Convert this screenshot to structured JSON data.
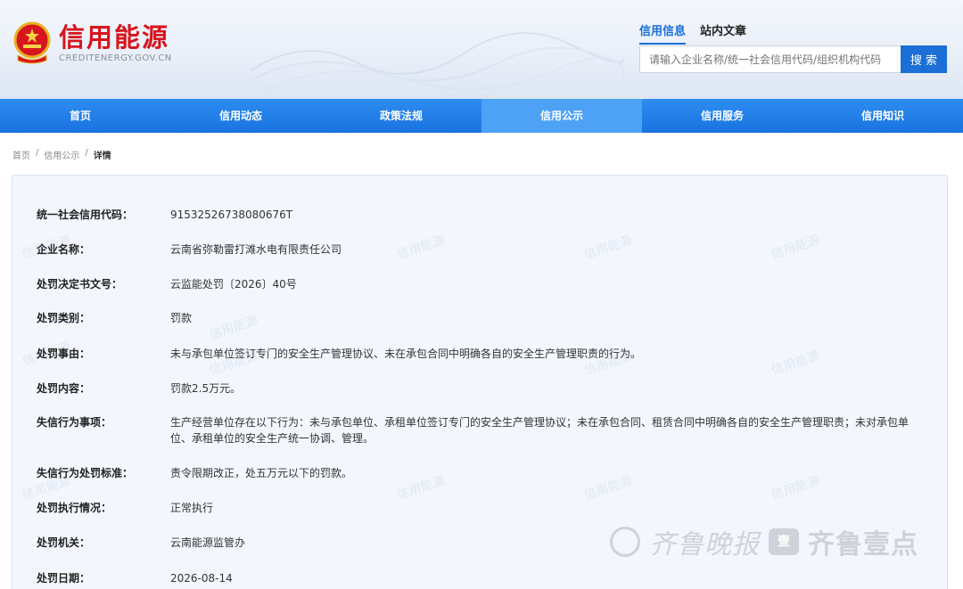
{
  "header": {
    "logo_title": "信用能源",
    "logo_sub": "CREDITENERGY.GOV.CN",
    "search_tabs": [
      "信用信息",
      "站内文章"
    ],
    "search_placeholder": "请输入企业名称/统一社会信用代码/组织机构代码",
    "search_button": "搜 索"
  },
  "nav": {
    "items": [
      "首页",
      "信用动态",
      "政策法规",
      "信用公示",
      "信用服务",
      "信用知识"
    ],
    "active": "信用公示"
  },
  "breadcrumb": {
    "home": "首页",
    "section": "信用公示",
    "current": "详情",
    "sep": "/"
  },
  "details": [
    {
      "label": "统一社会信用代码：",
      "value": "91532526738080676T"
    },
    {
      "label": "企业名称：",
      "value": "云南省弥勒雷打滩水电有限责任公司"
    },
    {
      "label": "处罚决定书文号：",
      "value": "云监能处罚〔2026〕40号"
    },
    {
      "label": "处罚类别：",
      "value": "罚款"
    },
    {
      "label": "处罚事由：",
      "value": "未与承包单位签订专门的安全生产管理协议、未在承包合同中明确各自的安全生产管理职责的行为。"
    },
    {
      "label": "处罚内容：",
      "value": "罚款2.5万元。"
    },
    {
      "label": "失信行为事项：",
      "value": "生产经营单位存在以下行为：未与承包单位、承租单位签订专门的安全生产管理协议；未在承包合同、租赁合同中明确各自的安全生产管理职责；未对承包单位、承租单位的安全生产统一协调、管理。"
    },
    {
      "label": "失信行为处罚标准：",
      "value": "责令限期改正，处五万元以下的罚款。"
    },
    {
      "label": "处罚执行情况：",
      "value": "正常执行"
    },
    {
      "label": "处罚机关：",
      "value": "云南能源监管办"
    },
    {
      "label": "处罚日期：",
      "value": "2026-08-14"
    }
  ],
  "panel_watermark": "信用能源",
  "brand_watermark": {
    "left": "齐鲁晚报",
    "seal": "壹",
    "right": "齐鲁壹点"
  },
  "colors": {
    "brand_red": "#d7151d",
    "nav_blue": "#1a73e0",
    "nav_active": "#4ea2f5",
    "panel_bg": "#f3f7fd"
  }
}
